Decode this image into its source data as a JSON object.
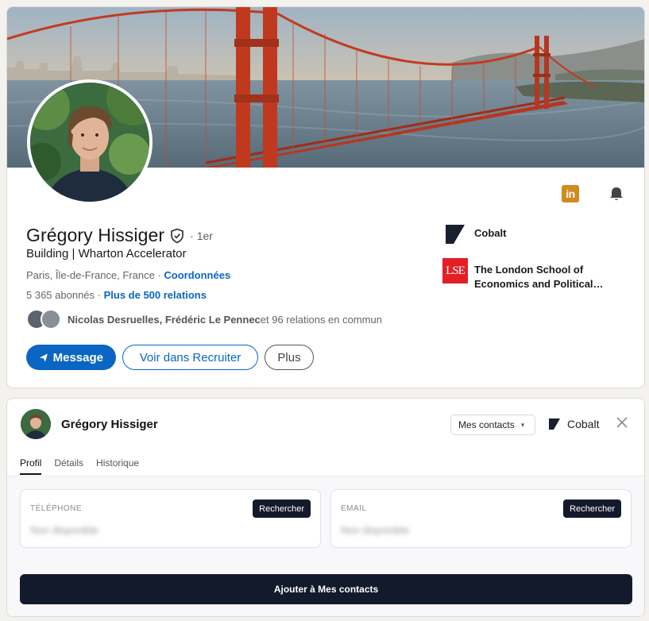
{
  "profile": {
    "name": "Grégory Hissiger",
    "degree": "· 1er",
    "headline": "Building | Wharton Accelerator",
    "location": "Paris, Île-de-France, France",
    "location_sep": " · ",
    "contact_link": "Coordonnées",
    "followers": "5 365 abonnés",
    "stats_sep": " · ",
    "relations_link": "Plus de 500 relations",
    "mutual_names": "Nicolas Desruelles, Frédéric Le Pennec",
    "mutual_rest": " et 96 relations en commun",
    "buttons": {
      "message": "Message",
      "recruiter": "Voir dans Recruiter",
      "more": "Plus"
    },
    "organizations": [
      {
        "name": "Cobalt",
        "icon": "cobalt-logo"
      },
      {
        "name": "The London School of Economics and Political…",
        "icon": "lse-logo",
        "logo_text": "LSE"
      }
    ],
    "icons": {
      "linkedin": "in"
    }
  },
  "panel": {
    "name": "Grégory Hissiger",
    "contacts_select": "Mes contacts",
    "brand": "Cobalt",
    "tabs": [
      "Profil",
      "Détails",
      "Historique"
    ],
    "active_tab": "Profil",
    "phone_label": "TÉLÉPHONE",
    "phone_value": "Non disponible",
    "email_label": "EMAIL",
    "email_value": "Non disponible",
    "search_label": "Rechercher",
    "add_button": "Ajouter à Mes contacts"
  },
  "colors": {
    "linkedin_blue": "#0a66c2",
    "dark_navy": "#131a2b",
    "lse_red": "#e21f26",
    "linkedin_badge": "#d08a1d"
  }
}
